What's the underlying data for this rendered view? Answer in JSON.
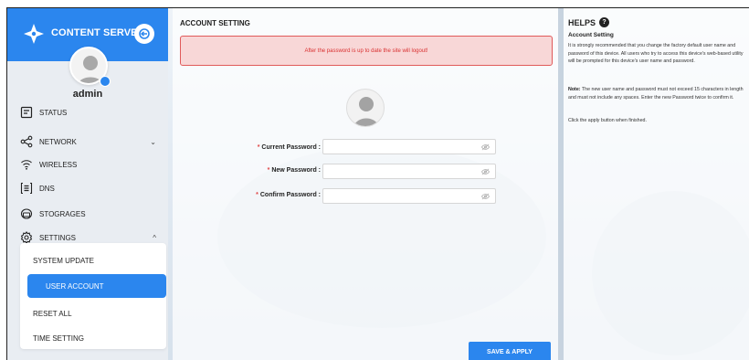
{
  "sidebar": {
    "brand": "CONTENT SERVER",
    "username": "admin",
    "nav": [
      {
        "label": "STATUS",
        "icon": "status-icon"
      },
      {
        "label": "NETWORK",
        "icon": "network-share-icon",
        "chevron": "⌄"
      },
      {
        "label": "WIRELESS",
        "icon": "wifi-icon"
      },
      {
        "label": "DNS",
        "icon": "dns-icon"
      },
      {
        "label": "STOGRAGES",
        "icon": "storage-icon"
      },
      {
        "label": "SETTINGS",
        "icon": "gear-icon",
        "chevron": "^"
      }
    ],
    "submenu": [
      {
        "label": "SYSTEM UPDATE"
      },
      {
        "label": "USER ACCOUNT",
        "active": true
      },
      {
        "label": "RESET ALL"
      },
      {
        "label": "TIME SETTING"
      }
    ]
  },
  "main": {
    "title": "ACCOUNT SETTING",
    "alert": "After the password is up to date the site will logout!",
    "fields": [
      {
        "label": "Current Password :",
        "required_mark": "*",
        "value": ""
      },
      {
        "label": "New Password :",
        "required_mark": "*",
        "value": ""
      },
      {
        "label": "Confirm Password :",
        "required_mark": "*",
        "value": ""
      }
    ],
    "save_label": "SAVE & APPLY"
  },
  "help": {
    "title": "HELPS",
    "q_mark": "?",
    "subtitle": "Account Setting",
    "para1": "It is strongly recommended that you change the factory default user name and password of this device. All users who try to access this device's web-based utility will be prompted for this device's user name and password.",
    "note_label": "Note:",
    "note_text": " The new user name and password must not exceed 15 characters in length and must not include any spaces. Enter the new Password twice to confirm it.",
    "para3": "Click the apply button when finished."
  },
  "colors": {
    "accent": "#2b86ee",
    "alert_bg": "#f8d7d7",
    "alert_border": "#e05a5a",
    "alert_text": "#d93030"
  }
}
